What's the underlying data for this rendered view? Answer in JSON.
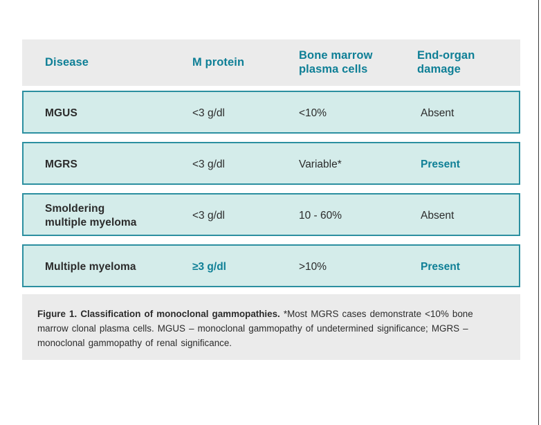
{
  "figure": {
    "accent_color": "#0e7f96",
    "row_border_color": "#2b8fa0",
    "row_fill_color": "#d4ecea",
    "panel_color": "#ebebeb",
    "columns": [
      {
        "key": "disease",
        "label": "Disease"
      },
      {
        "key": "mprotein",
        "label": "M protein"
      },
      {
        "key": "bmpc_l1",
        "label": "Bone marrow"
      },
      {
        "key": "bmpc_l2",
        "label": "plasma cells"
      },
      {
        "key": "endorgan_l1",
        "label": "End-organ"
      },
      {
        "key": "endorgan_l2",
        "label": "damage"
      }
    ],
    "rows": [
      {
        "disease_l1": "MGUS",
        "disease_l2": "",
        "mprotein": "<3 g/dl",
        "bmpc": "<10%",
        "endorgan": "Absent"
      },
      {
        "disease_l1": "MGRS",
        "disease_l2": "",
        "mprotein": "<3 g/dl",
        "bmpc": "Variable*",
        "endorgan": "Present"
      },
      {
        "disease_l1": "Smoldering",
        "disease_l2": "multiple myeloma",
        "mprotein": "<3 g/dl",
        "bmpc": "10 - 60%",
        "endorgan": "Absent"
      },
      {
        "disease_l1": "Multiple myeloma",
        "disease_l2": "",
        "mprotein": "≥3 g/dl",
        "bmpc": ">10%",
        "endorgan": "Present"
      }
    ],
    "caption": {
      "lead": "Figure 1. Classification of monoclonal gammopathies.",
      "body": " *Most MGRS cases demonstrate <10% bone marrow clonal plasma cells. MGUS – monoclonal gammopathy of undetermined significance; MGRS – monoclonal gammopathy of renal significance."
    }
  }
}
